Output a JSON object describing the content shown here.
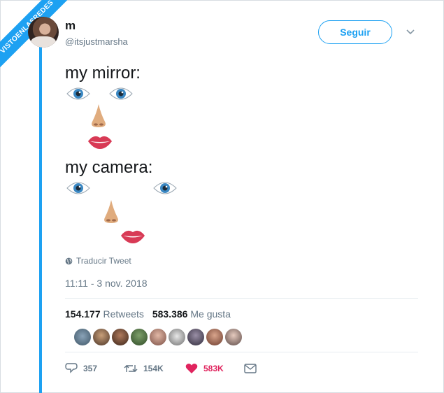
{
  "watermark": "VISTOENLASREDES",
  "author": {
    "name": "m",
    "handle": "@itsjustmarsha"
  },
  "follow_label": "Seguir",
  "tweet": {
    "line1": "my mirror:",
    "line2": "my camera:"
  },
  "translate_label": "Traducir Tweet",
  "timestamp": "11:11 - 3 nov. 2018",
  "stats": {
    "retweets_count": "154.177",
    "retweets_label": "Retweets",
    "likes_count": "583.386",
    "likes_label": "Me gusta"
  },
  "actions": {
    "replies": "357",
    "retweets": "154K",
    "likes": "583K"
  },
  "colors": {
    "accent": "#1da1f2",
    "like": "#e0245e",
    "muted": "#657786"
  },
  "icons": [
    "globe-icon",
    "chevron-down-icon",
    "reply-icon",
    "retweet-icon",
    "heart-icon",
    "mail-icon",
    "eye-icon",
    "nose-icon",
    "lips-icon"
  ]
}
